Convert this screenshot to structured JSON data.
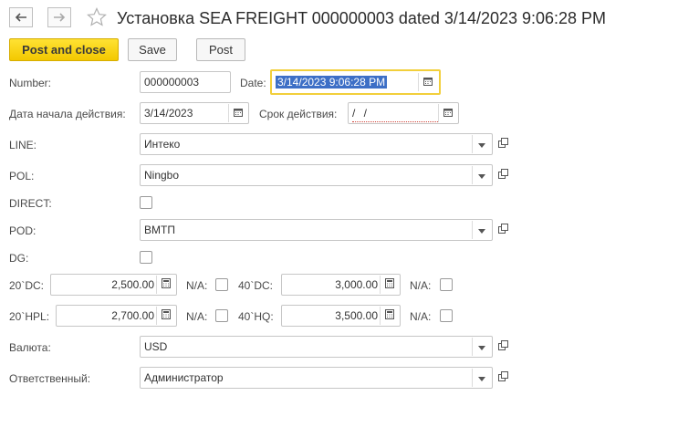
{
  "window": {
    "title": "Установка SEA FREIGHT 000000003 dated 3/14/2023 9:06:28 PM"
  },
  "toolbar": {
    "post_and_close": "Post and close",
    "save": "Save",
    "post": "Post"
  },
  "form": {
    "number_label": "Number:",
    "number_value": "000000003",
    "date_label": "Date:",
    "date_value": "3/14/2023  9:06:28 PM",
    "start_date_label": "Дата начала действия:",
    "start_date_value": "3/14/2023",
    "expiry_label": "Срок действия:",
    "expiry_value": " /  /",
    "line_label": "LINE:",
    "line_value": "Интеко",
    "pol_label": "POL:",
    "pol_value": "Ningbo",
    "direct_label": "DIRECT:",
    "pod_label": "POD:",
    "pod_value": "ВМТП",
    "dg_label": "DG:",
    "dc20_label": "20`DC:",
    "dc20_value": "2,500.00",
    "na_label": "N/A:",
    "dc40_label": "40`DC:",
    "dc40_value": "3,000.00",
    "hpl20_label": "20`HPL:",
    "hpl20_value": "2,700.00",
    "hq40_label": "40`HQ:",
    "hq40_value": "3,500.00",
    "currency_label": "Валюта:",
    "currency_value": "USD",
    "responsible_label": "Ответственный:",
    "responsible_value": "Администратор"
  },
  "icons": {
    "back": "arrow-left-icon",
    "forward": "arrow-right-icon",
    "favorite": "star-icon",
    "calendar": "calendar-icon",
    "calculator": "calculator-icon",
    "dropdown": "chevron-down-icon",
    "open": "open-form-icon"
  },
  "colors": {
    "primary_button": "#f3c800",
    "focus_border": "#f2cf3b",
    "selection": "#3d6fc6"
  }
}
